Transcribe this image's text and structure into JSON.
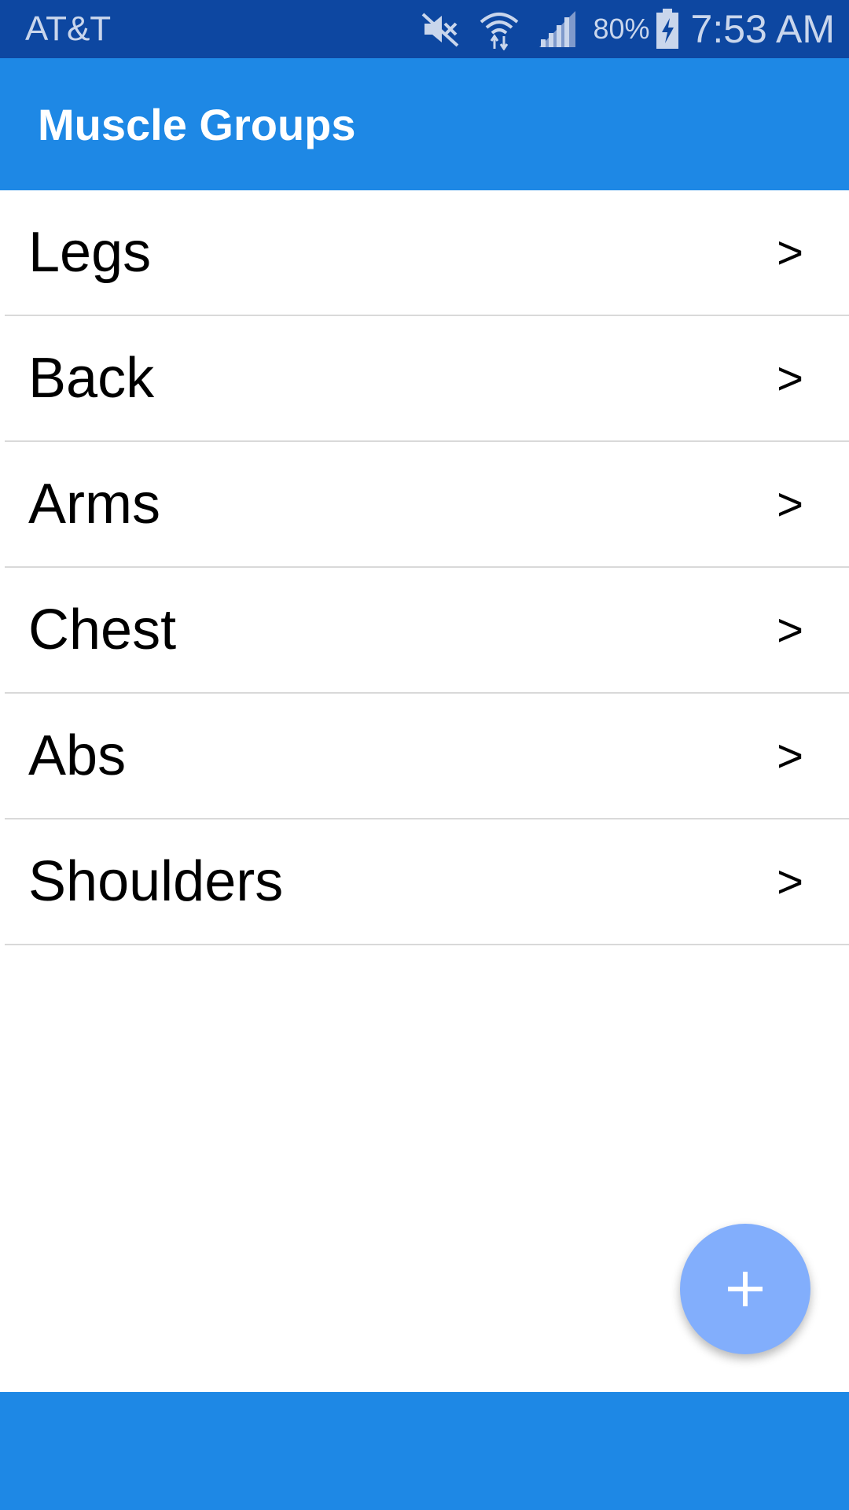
{
  "status_bar": {
    "carrier": "AT&T",
    "battery_percent": "80%",
    "time": "7:53 AM",
    "icons": [
      "mute-icon",
      "wifi-icon",
      "signal-icon",
      "battery-charging-icon"
    ]
  },
  "app_bar": {
    "title": "Muscle Groups"
  },
  "muscle_groups": [
    {
      "label": "Legs",
      "chevron": ">"
    },
    {
      "label": "Back",
      "chevron": ">"
    },
    {
      "label": "Arms",
      "chevron": ">"
    },
    {
      "label": "Chest",
      "chevron": ">"
    },
    {
      "label": "Abs",
      "chevron": ">"
    },
    {
      "label": "Shoulders",
      "chevron": ">"
    }
  ],
  "fab": {
    "icon": "plus-icon"
  },
  "colors": {
    "status_bar": "#0d47a1",
    "primary": "#1e88e5",
    "fab": "#82aefc",
    "divider": "#d9d9d9"
  }
}
